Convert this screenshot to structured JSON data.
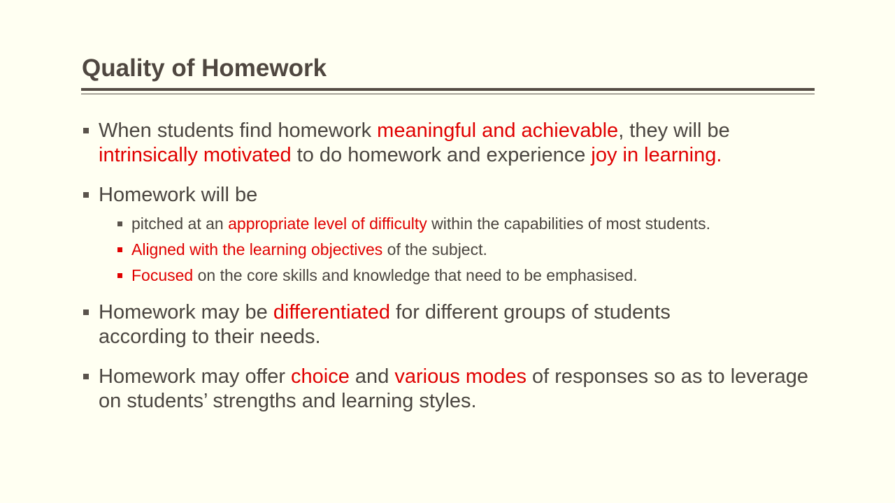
{
  "slide": {
    "title": "Quality of Homework",
    "colors": {
      "background": "#fffff2",
      "text": "#4a4540",
      "highlight": "#e00000",
      "rule": "#554d45"
    },
    "bullets": [
      {
        "segments": [
          {
            "text": "When students find homework ",
            "highlight": false
          },
          {
            "text": "meaningful and achievable",
            "highlight": true
          },
          {
            "text": ", they will be ",
            "highlight": false
          },
          {
            "text": "intrinsically motivated",
            "highlight": true
          },
          {
            "text": " to do homework and experience ",
            "highlight": false
          },
          {
            "text": "joy in learning.",
            "highlight": true
          }
        ]
      },
      {
        "segments": [
          {
            "text": "Homework will be",
            "highlight": false
          }
        ],
        "sub_items": [
          {
            "bullet_color": "grey",
            "segments": [
              {
                "text": "pitched at an ",
                "highlight": false
              },
              {
                "text": "appropriate level of difficulty",
                "highlight": true
              },
              {
                "text": " within the capabilities of most students.",
                "highlight": false
              }
            ]
          },
          {
            "bullet_color": "red",
            "segments": [
              {
                "text": "Aligned with the learning objectives",
                "highlight": true
              },
              {
                "text": " of the subject.",
                "highlight": false
              }
            ]
          },
          {
            "bullet_color": "red",
            "segments": [
              {
                "text": "Focused",
                "highlight": true
              },
              {
                "text": " on the core skills and knowledge that need to be emphasised.",
                "highlight": false
              }
            ]
          }
        ]
      },
      {
        "segments": [
          {
            "text": "Homework may be ",
            "highlight": false
          },
          {
            "text": "differentiated",
            "highlight": true
          },
          {
            "text": " for different groups of students according to their needs.",
            "highlight": false
          }
        ]
      },
      {
        "segments": [
          {
            "text": "Homework may offer ",
            "highlight": false
          },
          {
            "text": "choice",
            "highlight": true
          },
          {
            "text": " and ",
            "highlight": false
          },
          {
            "text": "various modes",
            "highlight": true
          },
          {
            "text": " of responses so as to leverage on students’ strengths and learning styles.",
            "highlight": false
          }
        ]
      }
    ]
  }
}
